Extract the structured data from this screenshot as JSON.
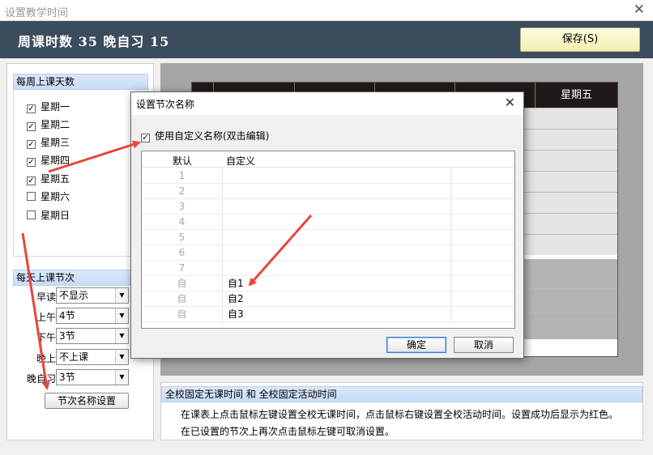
{
  "window": {
    "title": "设置教学时间",
    "close_glyph": "✕"
  },
  "header": {
    "stats": "周课时数 35 晚自习 15",
    "save_label": "保存(S)"
  },
  "left": {
    "days_title": "每周上课天数",
    "days": [
      {
        "label": "星期一",
        "checked": true
      },
      {
        "label": "星期二",
        "checked": true
      },
      {
        "label": "星期三",
        "checked": true
      },
      {
        "label": "星期四",
        "checked": true
      },
      {
        "label": "星期五",
        "checked": true
      },
      {
        "label": "星期六",
        "checked": false
      },
      {
        "label": "星期日",
        "checked": false
      }
    ],
    "periods_title": "每天上课节次",
    "periods": [
      {
        "label": "早读",
        "value": "不显示"
      },
      {
        "label": "上午",
        "value": "4节"
      },
      {
        "label": "下午",
        "value": "3节"
      },
      {
        "label": "晚上",
        "value": "不上课"
      },
      {
        "label": "晚自习",
        "value": "3节"
      }
    ],
    "names_button": "节次名称设置"
  },
  "grid": {
    "visible_header": "星期五"
  },
  "notice": {
    "title": "全校固定无课时间 和 全校固定活动时间",
    "line1": "在课表上点击鼠标左键设置全校无课时间，点击鼠标右键设置全校活动时间。设置成功后显示为红色。",
    "line2": "在已设置的节次上再次点击鼠标左键可取消设置。"
  },
  "dialog": {
    "title": "设置节次名称",
    "close_glyph": "✕",
    "checkbox_label": "使用自定义名称(双击编辑)",
    "checkbox_checked": true,
    "col_default": "默认",
    "col_custom": "自定义",
    "rows": [
      {
        "default": "1",
        "custom": ""
      },
      {
        "default": "2",
        "custom": ""
      },
      {
        "default": "3",
        "custom": ""
      },
      {
        "default": "4",
        "custom": ""
      },
      {
        "default": "5",
        "custom": ""
      },
      {
        "default": "6",
        "custom": ""
      },
      {
        "default": "7",
        "custom": ""
      },
      {
        "default": "自",
        "custom": "自1"
      },
      {
        "default": "自",
        "custom": "自2"
      },
      {
        "default": "自",
        "custom": "自3"
      }
    ],
    "ok_label": "确定",
    "cancel_label": "取消"
  },
  "colors": {
    "header_bg": "#3c4c5c",
    "arrow": "#e8453c",
    "section_bg": "#c9dcf6"
  }
}
